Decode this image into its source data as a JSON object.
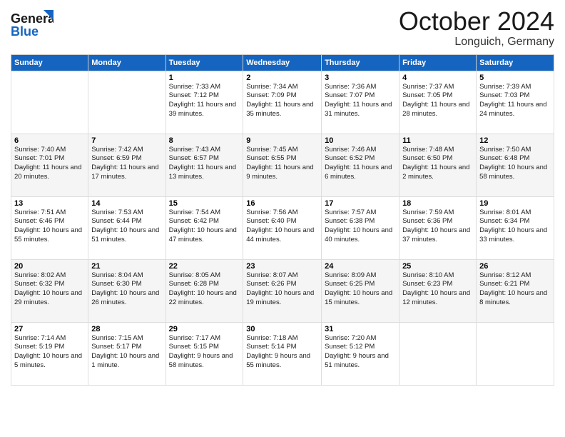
{
  "header": {
    "logo_line1": "General",
    "logo_line2": "Blue",
    "month_title": "October 2024",
    "location": "Longuich, Germany"
  },
  "days_of_week": [
    "Sunday",
    "Monday",
    "Tuesday",
    "Wednesday",
    "Thursday",
    "Friday",
    "Saturday"
  ],
  "weeks": [
    [
      {
        "day": "",
        "sunrise": "",
        "sunset": "",
        "daylight": ""
      },
      {
        "day": "",
        "sunrise": "",
        "sunset": "",
        "daylight": ""
      },
      {
        "day": "1",
        "sunrise": "Sunrise: 7:33 AM",
        "sunset": "Sunset: 7:12 PM",
        "daylight": "Daylight: 11 hours and 39 minutes."
      },
      {
        "day": "2",
        "sunrise": "Sunrise: 7:34 AM",
        "sunset": "Sunset: 7:09 PM",
        "daylight": "Daylight: 11 hours and 35 minutes."
      },
      {
        "day": "3",
        "sunrise": "Sunrise: 7:36 AM",
        "sunset": "Sunset: 7:07 PM",
        "daylight": "Daylight: 11 hours and 31 minutes."
      },
      {
        "day": "4",
        "sunrise": "Sunrise: 7:37 AM",
        "sunset": "Sunset: 7:05 PM",
        "daylight": "Daylight: 11 hours and 28 minutes."
      },
      {
        "day": "5",
        "sunrise": "Sunrise: 7:39 AM",
        "sunset": "Sunset: 7:03 PM",
        "daylight": "Daylight: 11 hours and 24 minutes."
      }
    ],
    [
      {
        "day": "6",
        "sunrise": "Sunrise: 7:40 AM",
        "sunset": "Sunset: 7:01 PM",
        "daylight": "Daylight: 11 hours and 20 minutes."
      },
      {
        "day": "7",
        "sunrise": "Sunrise: 7:42 AM",
        "sunset": "Sunset: 6:59 PM",
        "daylight": "Daylight: 11 hours and 17 minutes."
      },
      {
        "day": "8",
        "sunrise": "Sunrise: 7:43 AM",
        "sunset": "Sunset: 6:57 PM",
        "daylight": "Daylight: 11 hours and 13 minutes."
      },
      {
        "day": "9",
        "sunrise": "Sunrise: 7:45 AM",
        "sunset": "Sunset: 6:55 PM",
        "daylight": "Daylight: 11 hours and 9 minutes."
      },
      {
        "day": "10",
        "sunrise": "Sunrise: 7:46 AM",
        "sunset": "Sunset: 6:52 PM",
        "daylight": "Daylight: 11 hours and 6 minutes."
      },
      {
        "day": "11",
        "sunrise": "Sunrise: 7:48 AM",
        "sunset": "Sunset: 6:50 PM",
        "daylight": "Daylight: 11 hours and 2 minutes."
      },
      {
        "day": "12",
        "sunrise": "Sunrise: 7:50 AM",
        "sunset": "Sunset: 6:48 PM",
        "daylight": "Daylight: 10 hours and 58 minutes."
      }
    ],
    [
      {
        "day": "13",
        "sunrise": "Sunrise: 7:51 AM",
        "sunset": "Sunset: 6:46 PM",
        "daylight": "Daylight: 10 hours and 55 minutes."
      },
      {
        "day": "14",
        "sunrise": "Sunrise: 7:53 AM",
        "sunset": "Sunset: 6:44 PM",
        "daylight": "Daylight: 10 hours and 51 minutes."
      },
      {
        "day": "15",
        "sunrise": "Sunrise: 7:54 AM",
        "sunset": "Sunset: 6:42 PM",
        "daylight": "Daylight: 10 hours and 47 minutes."
      },
      {
        "day": "16",
        "sunrise": "Sunrise: 7:56 AM",
        "sunset": "Sunset: 6:40 PM",
        "daylight": "Daylight: 10 hours and 44 minutes."
      },
      {
        "day": "17",
        "sunrise": "Sunrise: 7:57 AM",
        "sunset": "Sunset: 6:38 PM",
        "daylight": "Daylight: 10 hours and 40 minutes."
      },
      {
        "day": "18",
        "sunrise": "Sunrise: 7:59 AM",
        "sunset": "Sunset: 6:36 PM",
        "daylight": "Daylight: 10 hours and 37 minutes."
      },
      {
        "day": "19",
        "sunrise": "Sunrise: 8:01 AM",
        "sunset": "Sunset: 6:34 PM",
        "daylight": "Daylight: 10 hours and 33 minutes."
      }
    ],
    [
      {
        "day": "20",
        "sunrise": "Sunrise: 8:02 AM",
        "sunset": "Sunset: 6:32 PM",
        "daylight": "Daylight: 10 hours and 29 minutes."
      },
      {
        "day": "21",
        "sunrise": "Sunrise: 8:04 AM",
        "sunset": "Sunset: 6:30 PM",
        "daylight": "Daylight: 10 hours and 26 minutes."
      },
      {
        "day": "22",
        "sunrise": "Sunrise: 8:05 AM",
        "sunset": "Sunset: 6:28 PM",
        "daylight": "Daylight: 10 hours and 22 minutes."
      },
      {
        "day": "23",
        "sunrise": "Sunrise: 8:07 AM",
        "sunset": "Sunset: 6:26 PM",
        "daylight": "Daylight: 10 hours and 19 minutes."
      },
      {
        "day": "24",
        "sunrise": "Sunrise: 8:09 AM",
        "sunset": "Sunset: 6:25 PM",
        "daylight": "Daylight: 10 hours and 15 minutes."
      },
      {
        "day": "25",
        "sunrise": "Sunrise: 8:10 AM",
        "sunset": "Sunset: 6:23 PM",
        "daylight": "Daylight: 10 hours and 12 minutes."
      },
      {
        "day": "26",
        "sunrise": "Sunrise: 8:12 AM",
        "sunset": "Sunset: 6:21 PM",
        "daylight": "Daylight: 10 hours and 8 minutes."
      }
    ],
    [
      {
        "day": "27",
        "sunrise": "Sunrise: 7:14 AM",
        "sunset": "Sunset: 5:19 PM",
        "daylight": "Daylight: 10 hours and 5 minutes."
      },
      {
        "day": "28",
        "sunrise": "Sunrise: 7:15 AM",
        "sunset": "Sunset: 5:17 PM",
        "daylight": "Daylight: 10 hours and 1 minute."
      },
      {
        "day": "29",
        "sunrise": "Sunrise: 7:17 AM",
        "sunset": "Sunset: 5:15 PM",
        "daylight": "Daylight: 9 hours and 58 minutes."
      },
      {
        "day": "30",
        "sunrise": "Sunrise: 7:18 AM",
        "sunset": "Sunset: 5:14 PM",
        "daylight": "Daylight: 9 hours and 55 minutes."
      },
      {
        "day": "31",
        "sunrise": "Sunrise: 7:20 AM",
        "sunset": "Sunset: 5:12 PM",
        "daylight": "Daylight: 9 hours and 51 minutes."
      },
      {
        "day": "",
        "sunrise": "",
        "sunset": "",
        "daylight": ""
      },
      {
        "day": "",
        "sunrise": "",
        "sunset": "",
        "daylight": ""
      }
    ]
  ]
}
